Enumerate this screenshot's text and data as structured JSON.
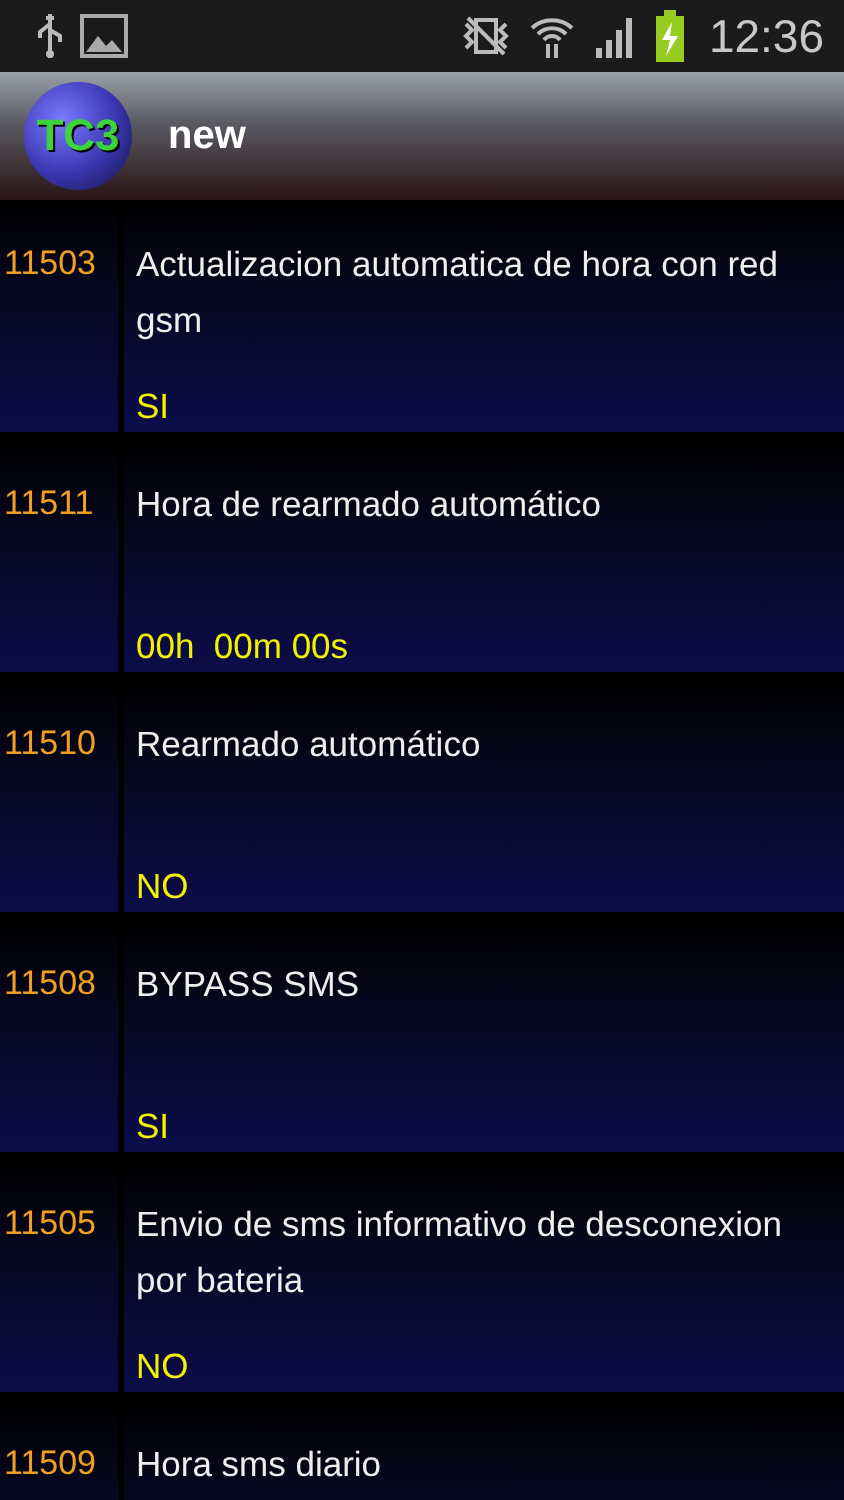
{
  "status_bar": {
    "time": "12:36"
  },
  "action_bar": {
    "logo": "TC3",
    "title": "new"
  },
  "items": [
    {
      "code": "11503",
      "title": "Actualizacion automatica de hora con red gsm",
      "value": "SI"
    },
    {
      "code": "11511",
      "title": "Hora de rearmado automático",
      "value": "00h  00m 00s"
    },
    {
      "code": "11510",
      "title": "Rearmado automático",
      "value": "NO"
    },
    {
      "code": "11508",
      "title": "BYPASS SMS",
      "value": "SI"
    },
    {
      "code": "11505",
      "title": "Envio de sms informativo de desconexion por bateria",
      "value": "NO"
    },
    {
      "code": "11509",
      "title": "Hora sms diario"
    }
  ]
}
